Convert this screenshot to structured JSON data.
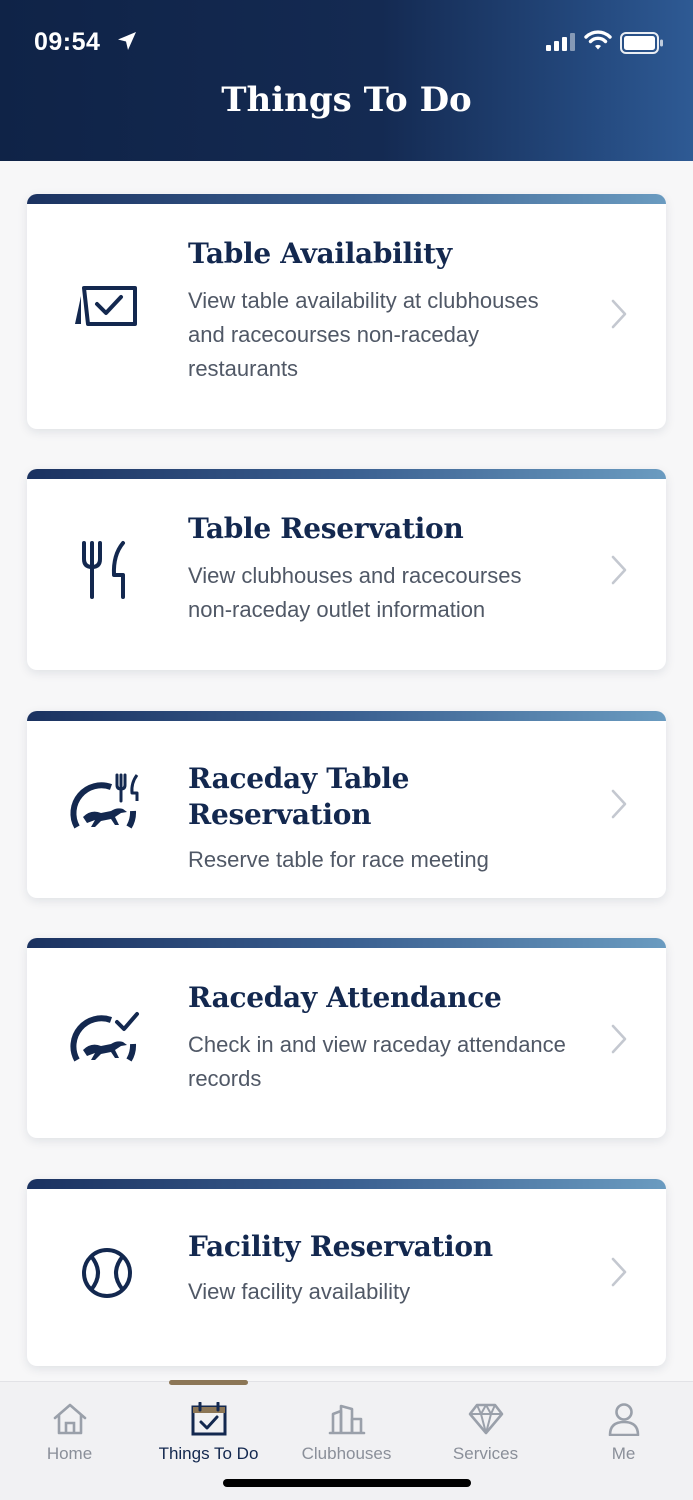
{
  "status_bar": {
    "time": "09:54"
  },
  "header": {
    "title": "Things To Do"
  },
  "cards": [
    {
      "title": "Table Availability",
      "description": "View table availability at clubhouses and racecourses non-raceday restaurants",
      "icon": "table-check-icon"
    },
    {
      "title": "Table Reservation",
      "description": "View clubhouses and racecourses non-raceday outlet information",
      "icon": "fork-knife-icon"
    },
    {
      "title": "Raceday Table Reservation",
      "description": "Reserve table for race meeting",
      "icon": "racehorse-dining-icon"
    },
    {
      "title": "Raceday Attendance",
      "description": "Check in and view raceday attendance records",
      "icon": "racehorse-check-icon"
    },
    {
      "title": "Facility Reservation",
      "description": "View facility availability",
      "icon": "tennis-ball-icon"
    }
  ],
  "tabbar": {
    "active": "Things To Do",
    "items": [
      {
        "label": "Home",
        "icon": "home-icon"
      },
      {
        "label": "Things To Do",
        "icon": "calendar-check-icon"
      },
      {
        "label": "Clubhouses",
        "icon": "building-icon"
      },
      {
        "label": "Services",
        "icon": "diamond-icon"
      },
      {
        "label": "Me",
        "icon": "person-icon"
      }
    ]
  },
  "colors": {
    "header_dark": "#0f2347",
    "header_light": "#2e5a94",
    "title_navy": "#13284f",
    "active_indicator": "#8c7656",
    "inactive_tab": "#8a8f99"
  }
}
